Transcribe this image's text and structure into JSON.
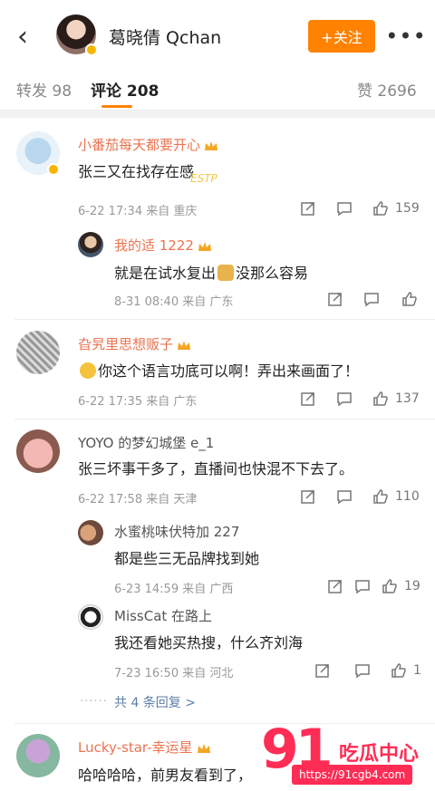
{
  "header": {
    "back_icon": "‹",
    "title": "葛晓倩 Qchan",
    "follow_label": "+关注",
    "more_icon": "•••"
  },
  "tabs": {
    "repost": "转发 98",
    "comments": "评论 208",
    "likes": "赞 2696"
  },
  "comments": [
    {
      "user": "小番茄每天都要开心",
      "text": "张三又在找存在感",
      "time": "6-22 17:34",
      "location": "来自 重庆",
      "likes": "159",
      "badge_text": "ESTP",
      "replies": [
        {
          "user": "我的适 1222",
          "text_before": "就是在试水复出",
          "text_after": "没那么容易",
          "time": "8-31 08:40",
          "location": "来自 广东",
          "likes": ""
        }
      ]
    },
    {
      "user": "旮旯里思想贩子",
      "text": "你这个语言功底可以啊！弄出来画面了！",
      "time": "6-22 17:35",
      "location": "来自 广东",
      "likes": "137",
      "replies": []
    },
    {
      "user": "YOYO 的梦幻城堡 e_1",
      "text": "张三坏事干多了，直播间也快混不下去了。",
      "time": "6-22 17:58",
      "location": "来自 天津",
      "likes": "110",
      "replies": [
        {
          "user": "水蜜桃味伏特加 227",
          "text": "都是些三无品牌找到她",
          "time": "6-23 14:59",
          "location": "来自 广西",
          "likes": "19"
        },
        {
          "user": "MissCat 在路上",
          "text": "我还看她买热搜，什么齐刘海",
          "time": "7-23 16:50",
          "location": "来自 河北",
          "likes": "1"
        }
      ],
      "more_replies": "共 4 条回复 >"
    },
    {
      "user": "Lucky-star-幸运星",
      "text": "哈哈哈哈，前男友看到了，",
      "replies": []
    }
  ],
  "watermark": {
    "logo_num": "91",
    "logo_text": "吃瓜中心",
    "url": "https://91cgb4.com"
  },
  "colors": {
    "accent": "#ff8200",
    "username": "#eb7350",
    "watermark": "#ff2d55"
  }
}
